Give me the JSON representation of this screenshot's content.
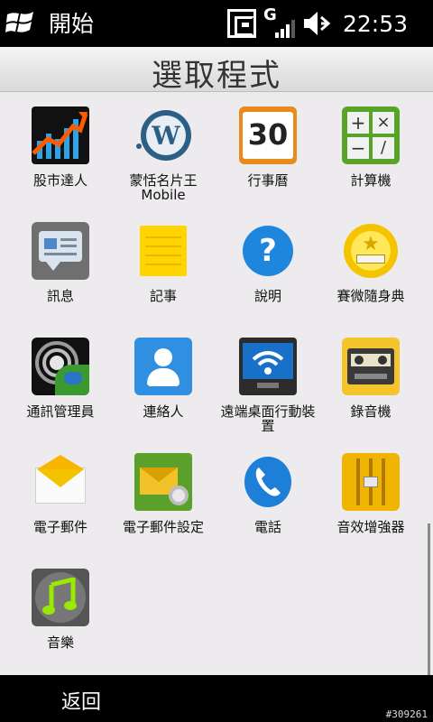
{
  "status_bar": {
    "start_label": "開始",
    "network_g": "G",
    "time": "22:53"
  },
  "title": "選取程式",
  "apps": [
    {
      "label": "股市達人",
      "icon": "stock-chart-icon"
    },
    {
      "label": "蒙恬名片王 Mobile",
      "icon": "business-card-icon"
    },
    {
      "label": "行事曆",
      "icon": "calendar-icon",
      "icon_text": "30"
    },
    {
      "label": "計算機",
      "icon": "calculator-icon"
    },
    {
      "label": "訊息",
      "icon": "message-icon"
    },
    {
      "label": "記事",
      "icon": "notes-icon"
    },
    {
      "label": "說明",
      "icon": "help-icon",
      "icon_text": "?"
    },
    {
      "label": "賽微隨身典",
      "icon": "dictionary-icon"
    },
    {
      "label": "通訊管理員",
      "icon": "comm-manager-icon"
    },
    {
      "label": "連絡人",
      "icon": "contacts-icon"
    },
    {
      "label": "遠端桌面行動裝置",
      "icon": "remote-desktop-icon"
    },
    {
      "label": "錄音機",
      "icon": "cassette-recorder-icon"
    },
    {
      "label": "電子郵件",
      "icon": "email-icon"
    },
    {
      "label": "電子郵件設定",
      "icon": "email-setup-icon"
    },
    {
      "label": "電話",
      "icon": "phone-icon"
    },
    {
      "label": "音效增強器",
      "icon": "equalizer-icon"
    },
    {
      "label": "音樂",
      "icon": "music-icon"
    }
  ],
  "bottom_bar": {
    "back_label": "返回",
    "watermark": "#309261"
  }
}
